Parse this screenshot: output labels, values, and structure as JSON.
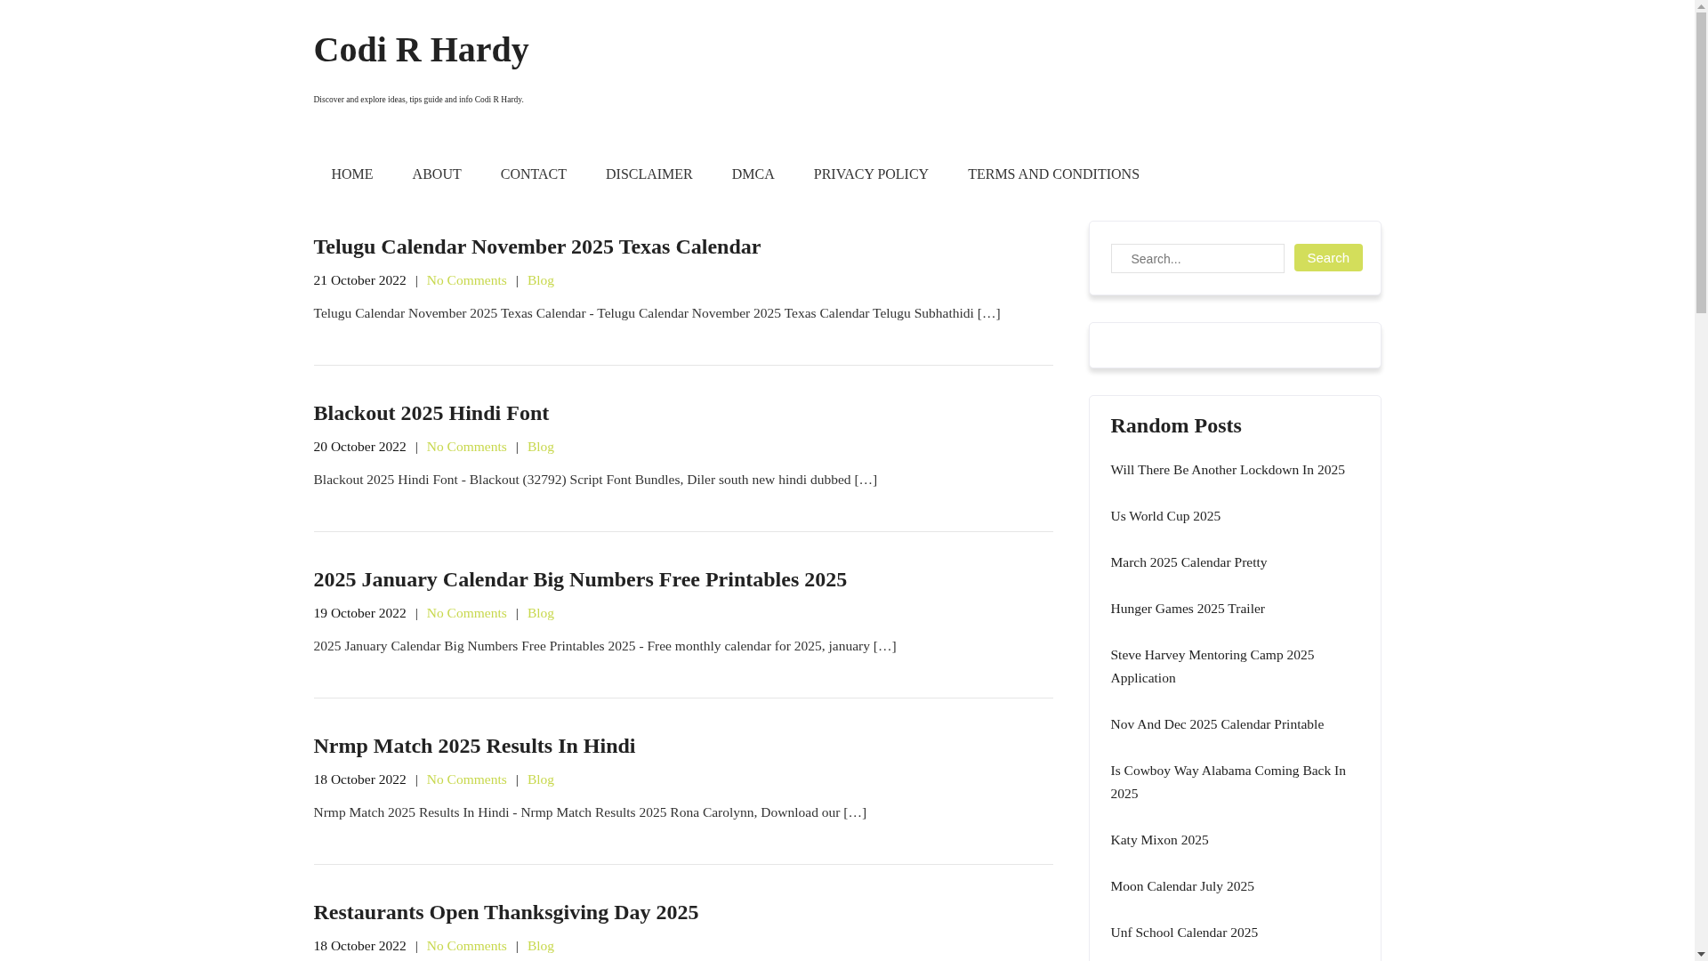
{
  "site": {
    "title": "Codi R Hardy",
    "tagline": "Discover and explore ideas, tips guide and info Codi R Hardy."
  },
  "nav": [
    "HOME",
    "ABOUT",
    "CONTACT",
    "DISCLAIMER",
    "DMCA",
    "PRIVACY POLICY",
    "TERMS AND CONDITIONS"
  ],
  "posts": [
    {
      "title": "Telugu Calendar November 2025 Texas Calendar",
      "meta": [
        {
          "kind": "date",
          "text": "21 October 2022"
        },
        {
          "kind": "separator",
          "text": "|"
        },
        {
          "kind": "comments",
          "text": "No Comments"
        },
        {
          "kind": "separator",
          "text": "|"
        },
        {
          "kind": "category",
          "text": "Blog"
        }
      ],
      "excerpt": "Telugu Calendar November 2025 Texas Calendar - Telugu Calendar November 2025 Texas Calendar Telugu Subhathidi […]"
    },
    {
      "title": "Blackout 2025 Hindi Font",
      "meta": [
        {
          "kind": "date",
          "text": "20 October 2022"
        },
        {
          "kind": "separator",
          "text": "|"
        },
        {
          "kind": "comments",
          "text": "No Comments"
        },
        {
          "kind": "separator",
          "text": "|"
        },
        {
          "kind": "category",
          "text": "Blog"
        }
      ],
      "excerpt": "Blackout 2025 Hindi Font - Blackout (32792) Script Font Bundles, Diler south new hindi dubbed […]"
    },
    {
      "title": "2025 January Calendar Big Numbers Free Printables 2025",
      "meta": [
        {
          "kind": "date",
          "text": "19 October 2022"
        },
        {
          "kind": "separator",
          "text": "|"
        },
        {
          "kind": "comments",
          "text": "No Comments"
        },
        {
          "kind": "separator",
          "text": "|"
        },
        {
          "kind": "category",
          "text": "Blog"
        }
      ],
      "excerpt": "2025 January Calendar Big Numbers Free Printables 2025 - Free monthly calendar for 2025, january […]"
    },
    {
      "title": "Nrmp Match 2025 Results In Hindi",
      "meta": [
        {
          "kind": "date",
          "text": "18 October 2022"
        },
        {
          "kind": "separator",
          "text": "|"
        },
        {
          "kind": "comments",
          "text": "No Comments"
        },
        {
          "kind": "separator",
          "text": "|"
        },
        {
          "kind": "category",
          "text": "Blog"
        }
      ],
      "excerpt": "Nrmp Match 2025 Results In Hindi - Nrmp Match Results 2025 Rona Carolynn, Download our […]"
    },
    {
      "title": "Restaurants Open Thanksgiving Day 2025",
      "meta": [
        {
          "kind": "date",
          "text": "18 October 2022"
        },
        {
          "kind": "separator",
          "text": "|"
        },
        {
          "kind": "comments",
          "text": "No Comments"
        },
        {
          "kind": "separator",
          "text": "|"
        },
        {
          "kind": "category",
          "text": "Blog"
        }
      ]
    }
  ],
  "sidebar": {
    "search": {
      "placeholder": "Search...",
      "button": "Search"
    },
    "random_posts": {
      "heading": "Random Posts",
      "items": [
        "Will There Be Another Lockdown In 2025",
        "Us World Cup 2025",
        "March 2025 Calendar Pretty",
        "Hunger Games 2025 Trailer",
        "Steve Harvey Mentoring Camp 2025 Application",
        "Nov And Dec 2025 Calendar Printable",
        "Is Cowboy Way Alabama Coming Back In 2025",
        "Katy Mixon 2025",
        "Moon Calendar July 2025",
        "Unf School Calendar 2025"
      ]
    }
  }
}
